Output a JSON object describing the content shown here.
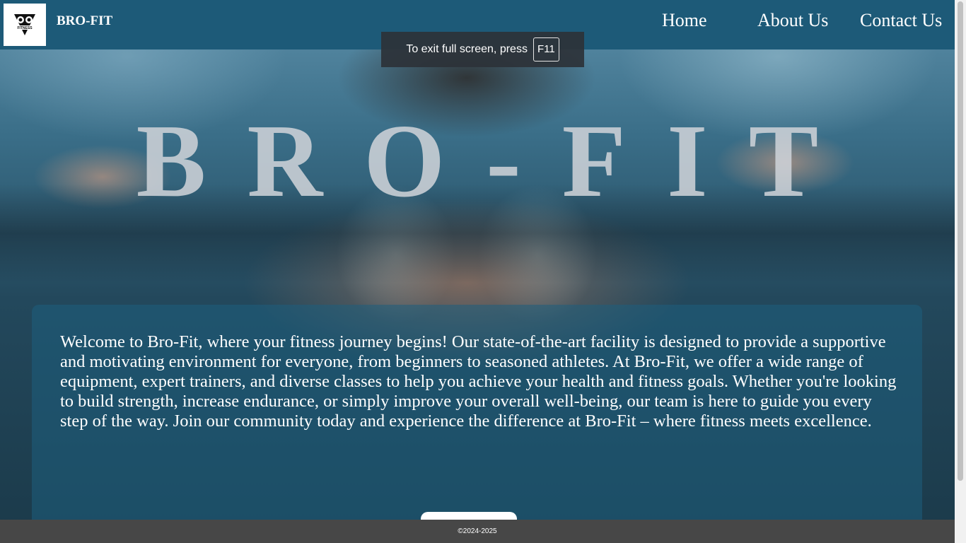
{
  "header": {
    "brand": "BRO-FIT",
    "logo_text": "FITNESS",
    "nav": {
      "home": "Home",
      "about": "About Us",
      "contact": "Contact Us"
    }
  },
  "toast": {
    "message": "To exit full screen, press",
    "key": "F11"
  },
  "hero": {
    "title": "BRO-FIT"
  },
  "welcome": {
    "text": "Welcome to Bro-Fit, where your fitness journey begins! Our state-of-the-art facility is designed to provide a supportive and motivating environment for everyone, from beginners to seasoned athletes. At Bro-Fit, we offer a wide range of equipment, expert trainers, and diverse classes to help you achieve your health and fitness goals. Whether you're looking to build strength, increase endurance, or simply improve your overall well-being, our team is here to guide you every step of the way. Join our community today and experience the difference at Bro-Fit – where fitness meets excellence."
  },
  "footer": {
    "copyright": "©2024-2025"
  },
  "colors": {
    "header_bg": "#1d5a78",
    "footer_bg": "#474747",
    "card_bg": "rgba(30,95,125,0.55)"
  }
}
